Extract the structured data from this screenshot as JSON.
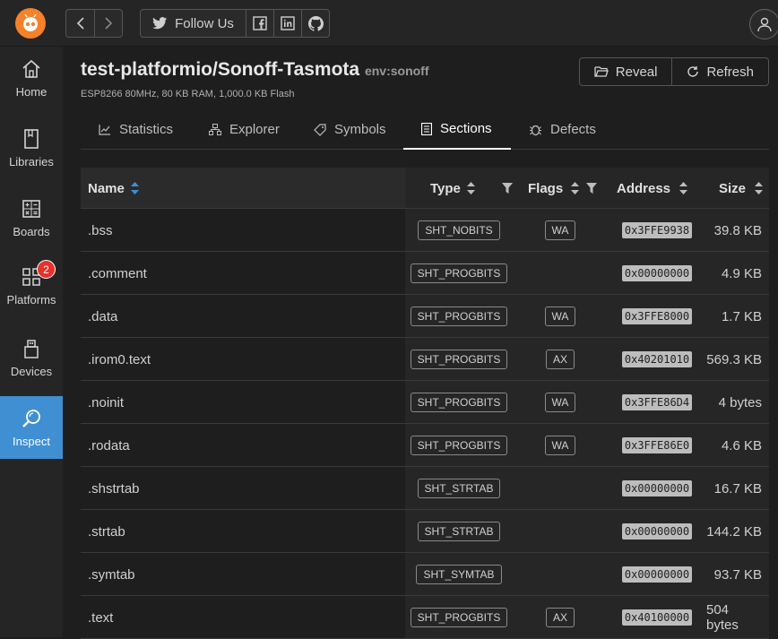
{
  "topbar": {
    "follow_label": "Follow Us"
  },
  "sidebar": {
    "items": [
      {
        "label": "Home",
        "icon": "home-icon"
      },
      {
        "label": "Libraries",
        "icon": "book-icon"
      },
      {
        "label": "Boards",
        "icon": "calculator-icon"
      },
      {
        "label": "Platforms",
        "icon": "grid-icon",
        "badge": "2"
      },
      {
        "label": "Devices",
        "icon": "usb-icon"
      },
      {
        "label": "Inspect",
        "icon": "inspect-icon",
        "active": true
      }
    ]
  },
  "header": {
    "title": "test-platformio/Sonoff-Tasmota",
    "env": "env:sonoff",
    "subtitle": "ESP8266 80MHz, 80 KB RAM, 1,000.0 KB Flash",
    "reveal_label": "Reveal",
    "refresh_label": "Refresh"
  },
  "tabs": [
    {
      "label": "Statistics",
      "icon": "chart-icon"
    },
    {
      "label": "Explorer",
      "icon": "sitemap-icon"
    },
    {
      "label": "Symbols",
      "icon": "tag-icon"
    },
    {
      "label": "Sections",
      "icon": "list-icon",
      "active": true
    },
    {
      "label": "Defects",
      "icon": "bug-icon"
    }
  ],
  "table": {
    "columns": {
      "name": "Name",
      "type": "Type",
      "flags": "Flags",
      "address": "Address",
      "size": "Size"
    },
    "rows": [
      {
        "name": ".bss",
        "type": "SHT_NOBITS",
        "flags": "WA",
        "address": "0x3FFE9938",
        "size": "39.8 KB"
      },
      {
        "name": ".comment",
        "type": "SHT_PROGBITS",
        "flags": "",
        "address": "0x00000000",
        "size": "4.9 KB"
      },
      {
        "name": ".data",
        "type": "SHT_PROGBITS",
        "flags": "WA",
        "address": "0x3FFE8000",
        "size": "1.7 KB"
      },
      {
        "name": ".irom0.text",
        "type": "SHT_PROGBITS",
        "flags": "AX",
        "address": "0x40201010",
        "size": "569.3 KB"
      },
      {
        "name": ".noinit",
        "type": "SHT_PROGBITS",
        "flags": "WA",
        "address": "0x3FFE86D4",
        "size": "4 bytes"
      },
      {
        "name": ".rodata",
        "type": "SHT_PROGBITS",
        "flags": "WA",
        "address": "0x3FFE86E0",
        "size": "4.6 KB"
      },
      {
        "name": ".shstrtab",
        "type": "SHT_STRTAB",
        "flags": "",
        "address": "0x00000000",
        "size": "16.7 KB"
      },
      {
        "name": ".strtab",
        "type": "SHT_STRTAB",
        "flags": "",
        "address": "0x00000000",
        "size": "144.2 KB"
      },
      {
        "name": ".symtab",
        "type": "SHT_SYMTAB",
        "flags": "",
        "address": "0x00000000",
        "size": "93.7 KB"
      },
      {
        "name": ".text",
        "type": "SHT_PROGBITS",
        "flags": "AX",
        "address": "0x40100000",
        "size": "504 bytes"
      }
    ]
  },
  "colors": {
    "accent": "#3f8fd2",
    "logo": "#f5822a",
    "badge": "#e5322d"
  }
}
